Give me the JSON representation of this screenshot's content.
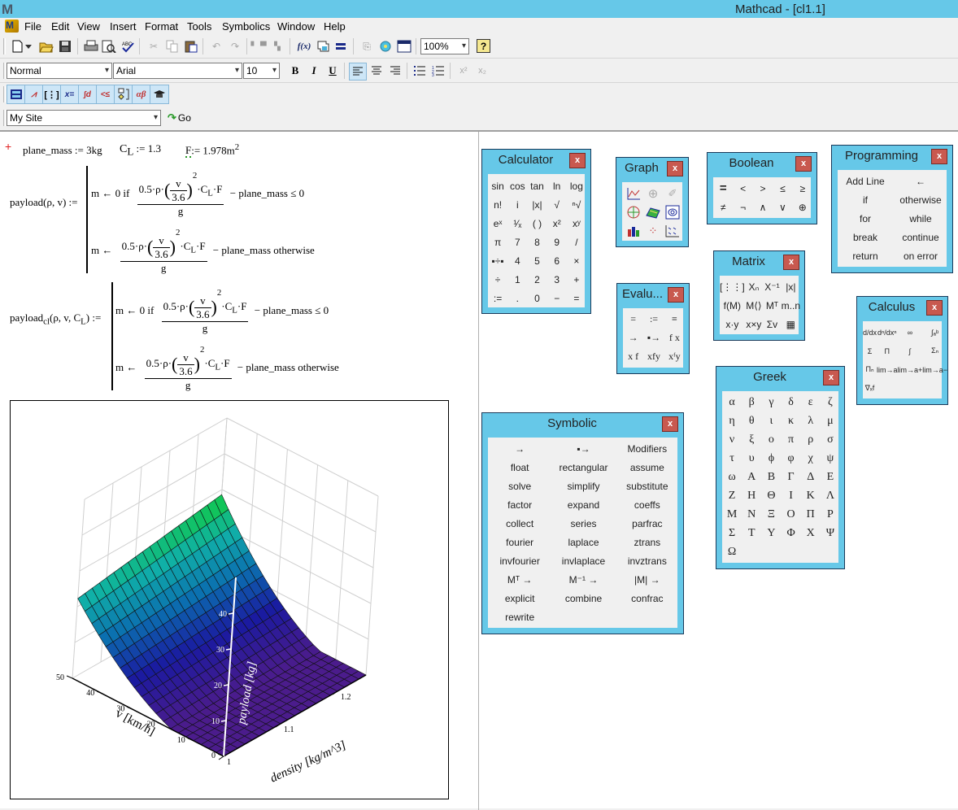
{
  "window": {
    "title": "Mathcad - [cl1.1]",
    "logo": "M"
  },
  "menu": [
    "File",
    "Edit",
    "View",
    "Insert",
    "Format",
    "Tools",
    "Symbolics",
    "Window",
    "Help"
  ],
  "toolbar": {
    "zoom": "100%",
    "style": "Normal",
    "font": "Arial",
    "size": "10",
    "bold": "B",
    "italic": "I",
    "underline": "U",
    "fx": "f(x)",
    "site": "My Site",
    "go": "Go"
  },
  "worksheet": {
    "defs": {
      "plane_mass": "plane_mass := 3kg",
      "cl_name": "C",
      "cl_sub": "L",
      "cl_val": " := 1.3",
      "f_name": "F",
      "f_val": ":= 1.978m",
      "f_exp": "2"
    },
    "func1": {
      "lhs": "payload(ρ, v) :=",
      "row1_prefix": "m ← 0  if",
      "row1_suffix": "− plane_mass ≤ 0",
      "row2_prefix": "m ←",
      "row2_suffix": "− plane_mass   otherwise"
    },
    "func2": {
      "lhs_name": "payload",
      "lhs_sub": "cl",
      "lhs_args": "(ρ, v, C",
      "lhs_args_sub": "L",
      "lhs_tail": ") :=",
      "row1_prefix": "m ← 0  if",
      "row1_suffix": "− plane_mass ≤ 0",
      "row2_prefix": "m ←",
      "row2_suffix": "− plane_mass   otherwise"
    },
    "fraction": {
      "num_a": "0.5·ρ·",
      "paren_num": "v",
      "paren_den": "3.6",
      "exp": "2",
      "num_b": "·C",
      "num_b_sub": "L",
      "num_c": "·F",
      "den": "g"
    }
  },
  "chart_data": {
    "type": "surface3d",
    "xlabel": "density [kg/m^3]",
    "ylabel": "v [km/h]",
    "zlabel": "payload [kg]",
    "x_ticks": [
      "1",
      "1.1",
      "1.2"
    ],
    "y_ticks": [
      "0",
      "10",
      "20",
      "30",
      "40",
      "50"
    ],
    "z_ticks": [
      "10",
      "20",
      "30",
      "40"
    ],
    "xlim": [
      1.0,
      1.25
    ],
    "ylim": [
      0,
      50
    ],
    "zlim": [
      0,
      50
    ],
    "colormap": [
      "#4b1c8c",
      "#1a1aa0",
      "#0b6fb0",
      "#10b0a8",
      "#12cc40"
    ]
  },
  "palettes": {
    "calculator": {
      "title": "Calculator",
      "cells": [
        "sin",
        "cos",
        "tan",
        "ln",
        "log",
        "n!",
        "i",
        "|x|",
        "√",
        "ⁿ√",
        "eˣ",
        "¹⁄ₓ",
        "( )",
        "x²",
        "xʸ",
        "π",
        "7",
        "8",
        "9",
        "/",
        "▪÷▪",
        "4",
        "5",
        "6",
        "×",
        "÷",
        "1",
        "2",
        "3",
        "+",
        ":=",
        ".",
        "0",
        "−",
        "="
      ]
    },
    "graph": {
      "title": "Graph",
      "icons": [
        "xy-plot-icon",
        "polar-plot-icon",
        "surface-plot-icon",
        "polar-plot2-icon",
        "3d-surface-icon",
        "contour-plot-icon",
        "bar-plot-icon",
        "scatter-plot-icon",
        "vector-field-icon"
      ]
    },
    "boolean": {
      "title": "Boolean",
      "cells": [
        "=",
        "<",
        ">",
        "≤",
        "≥",
        "≠",
        "¬",
        "∧",
        "∨",
        "⊕"
      ]
    },
    "programming": {
      "title": "Programming",
      "cells": [
        "Add Line",
        "←",
        "if",
        "otherwise",
        "for",
        "while",
        "break",
        "continue",
        "return",
        "on error"
      ]
    },
    "evaluation": {
      "title": "Evalu...",
      "cells": [
        "=",
        ":=",
        "≡",
        "→",
        "▪→",
        "f x",
        "x f",
        "xfy",
        "xᶠy"
      ]
    },
    "matrix": {
      "title": "Matrix",
      "cells": [
        "[⋮⋮]",
        "Xₙ",
        "X⁻¹",
        "|x|",
        "f(M)",
        "M⟨⟩",
        "Mᵀ",
        "m..n",
        "x·y",
        "x×y",
        "Σv",
        "▦"
      ]
    },
    "calculus": {
      "title": "Calculus",
      "cells": [
        "d/dx",
        "dⁿ/dxⁿ",
        "∞",
        "∫ₐᵇ",
        "Σ",
        "Π",
        "∫",
        "Σₙ",
        "Πₙ",
        "lim→a",
        "lim→a+",
        "lim→a−",
        "∇ₓf"
      ]
    },
    "greek": {
      "title": "Greek",
      "cells": [
        "α",
        "β",
        "γ",
        "δ",
        "ε",
        "ζ",
        "η",
        "θ",
        "ι",
        "κ",
        "λ",
        "μ",
        "ν",
        "ξ",
        "ο",
        "π",
        "ρ",
        "σ",
        "τ",
        "υ",
        "ϕ",
        "φ",
        "χ",
        "ψ",
        "ω",
        "Α",
        "Β",
        "Γ",
        "Δ",
        "Ε",
        "Ζ",
        "Η",
        "Θ",
        "Ι",
        "Κ",
        "Λ",
        "Μ",
        "Ν",
        "Ξ",
        "Ο",
        "Π",
        "Ρ",
        "Σ",
        "Τ",
        "Υ",
        "Φ",
        "Χ",
        "Ψ",
        "Ω"
      ]
    },
    "symbolic": {
      "title": "Symbolic",
      "cells": [
        "→",
        "▪→",
        "Modifiers",
        "float",
        "rectangular",
        "assume",
        "solve",
        "simplify",
        "substitute",
        "factor",
        "expand",
        "coeffs",
        "collect",
        "series",
        "parfrac",
        "fourier",
        "laplace",
        "ztrans",
        "invfourier",
        "invlaplace",
        "invztrans",
        "Mᵀ →",
        "M⁻¹ →",
        "|M| →",
        "explicit",
        "combine",
        "confrac",
        "rewrite"
      ]
    }
  },
  "close_label": "x"
}
